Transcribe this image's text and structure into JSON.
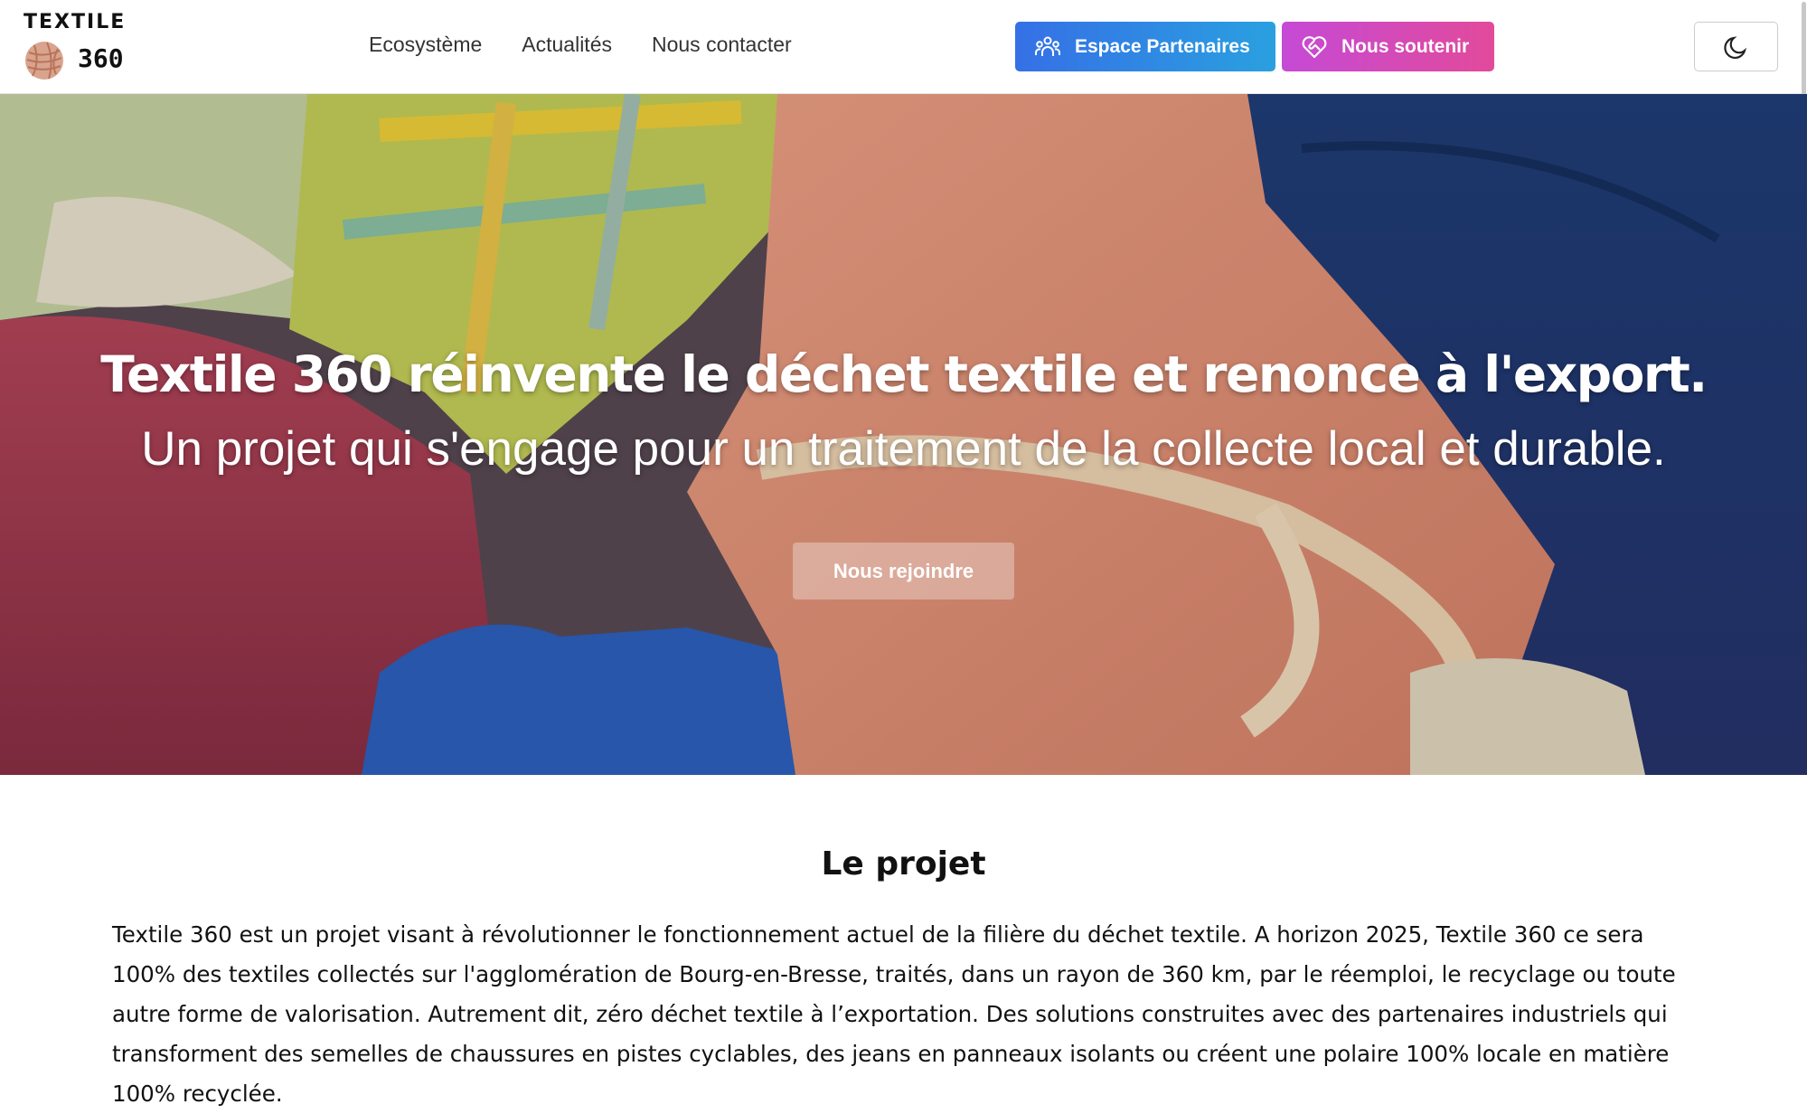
{
  "header": {
    "logo": {
      "line1": "TEXTILE",
      "line2": "360",
      "icon": "yarn-ball-icon"
    },
    "nav": [
      {
        "label": "Ecosystème"
      },
      {
        "label": "Actualités"
      },
      {
        "label": "Nous contacter"
      }
    ],
    "partner_button": {
      "label": "Espace Partenaires",
      "icon": "users-icon",
      "colors": [
        "#3570e6",
        "#2aa0e0"
      ]
    },
    "support_button": {
      "label": "Nous soutenir",
      "icon": "heart-handshake-icon",
      "colors": [
        "#c54ad6",
        "#e24a9b"
      ]
    },
    "theme_toggle": {
      "icon": "moon-icon"
    }
  },
  "hero": {
    "title": "Textile 360 réinvente le déchet textile et renonce à l'export.",
    "subtitle": "Un projet qui s'engage pour un traitement de la collecte local et durable.",
    "cta": "Nous rejoindre"
  },
  "projet": {
    "title": "Le projet",
    "text": "Textile 360 est un projet visant à révolutionner le fonctionnement actuel de la filière du déchet textile. A horizon 2025, Textile 360 ce sera 100% des textiles collectés sur l'agglomération de Bourg-en-Bresse, traités, dans un rayon de 360 km, par le réemploi, le recyclage ou toute autre forme de valorisation. Autrement dit, zéro déchet textile à l’exportation. Des solutions construites avec des partenaires industriels qui transforment des semelles de chaussures en pistes cyclables, des jeans en panneaux isolants ou créent une polaire 100% locale en matière 100% recyclée."
  }
}
